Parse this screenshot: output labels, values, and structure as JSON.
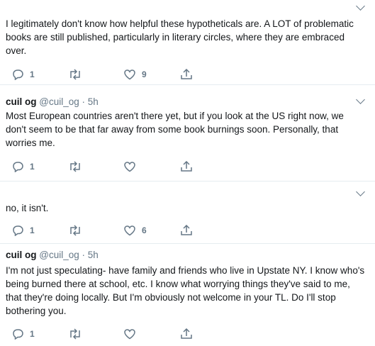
{
  "tweets": [
    {
      "name": "",
      "handle": "",
      "time": "",
      "text": "I legitimately don't know how helpful these hypotheticals are. A LOT of problematic books are still published, particularly in literary circles, where they are embraced over.",
      "reply_count": "1",
      "retweet_count": "",
      "like_count": "9"
    },
    {
      "name": "cuil og",
      "handle": "@cuil_og",
      "time": "· 5h",
      "text": "Most European countries aren't there yet, but if you look at the US right now, we don't seem to be that far away from some book burnings soon. Personally, that worries me.",
      "reply_count": "1",
      "retweet_count": "",
      "like_count": ""
    },
    {
      "name": "",
      "handle": "",
      "time": "",
      "text": "no, it isn't.",
      "reply_count": "1",
      "retweet_count": "",
      "like_count": "6"
    },
    {
      "name": "cuil og",
      "handle": "@cuil_og",
      "time": "· 5h",
      "text": "I'm not just speculating- have family and friends who live in Upstate NY. I know who's being burned there at school, etc. I know what worrying things they've said to me, that they're doing locally. But I'm obviously not welcome in your TL. Do I'll stop bothering you.",
      "reply_count": "1",
      "retweet_count": "",
      "like_count": ""
    }
  ]
}
